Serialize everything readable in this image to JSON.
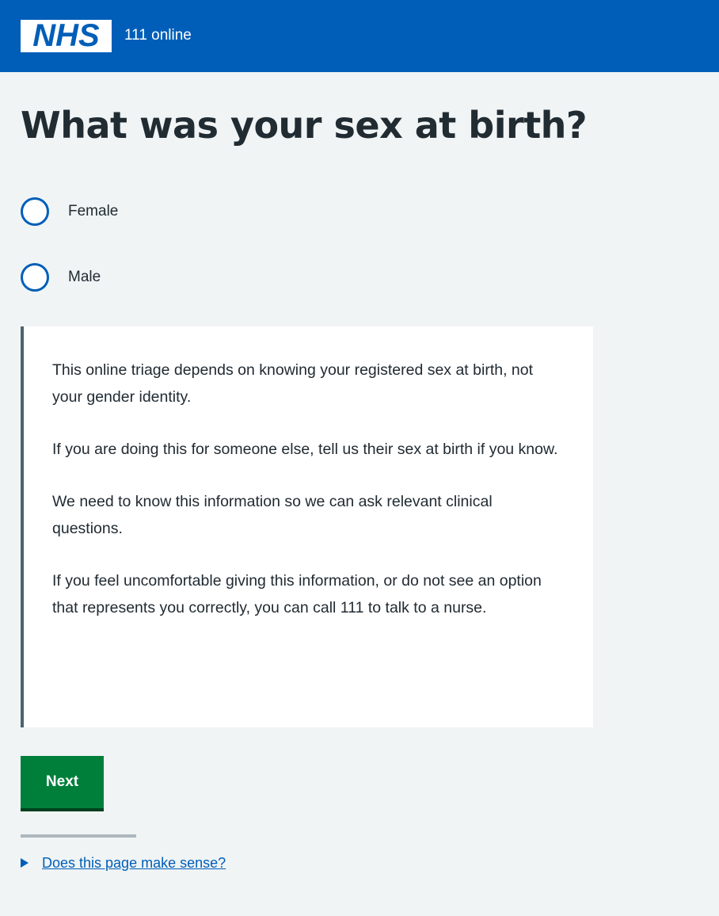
{
  "header": {
    "logo_text": "NHS",
    "service_name": "111 online",
    "color": "#005eb8"
  },
  "question": {
    "title": "What was your sex at birth?"
  },
  "options": [
    {
      "label": "Female",
      "selected": false
    },
    {
      "label": "Male",
      "selected": false
    }
  ],
  "inset": {
    "paragraphs": [
      "This online triage depends on knowing your registered sex at birth, not your gender identity.",
      "If you are doing this for someone else, tell us their sex at birth if you know.",
      "We need to know this information so we can ask relevant clinical questions.",
      "If you feel uncomfortable giving this information, or do not see an option that represents you correctly, you can call 111 to talk to a nurse."
    ]
  },
  "actions": {
    "next_label": "Next",
    "button_color": "#007f3b"
  },
  "feedback": {
    "link_text": "Does this page make sense?",
    "icon": "triangle-right-icon"
  }
}
